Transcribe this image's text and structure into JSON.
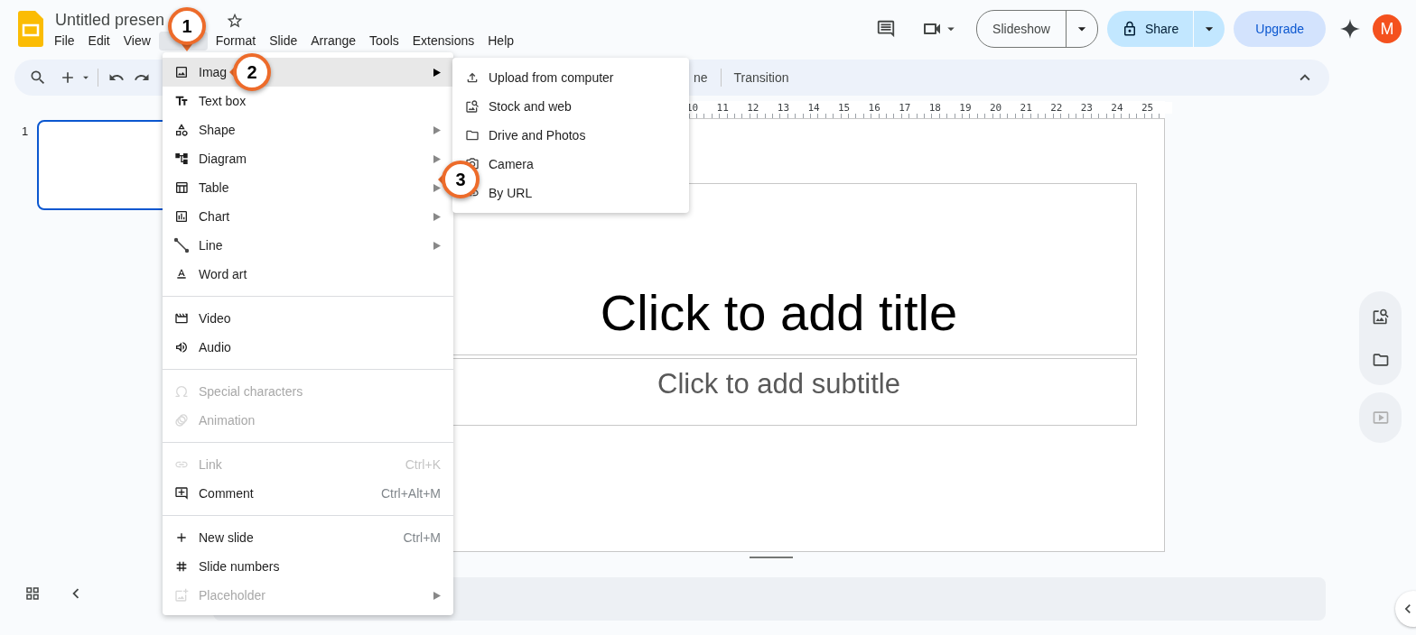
{
  "document": {
    "title": "Untitled presen",
    "starred": false
  },
  "menubar": [
    {
      "label": "File",
      "selected": false
    },
    {
      "label": "Edit",
      "selected": false
    },
    {
      "label": "View",
      "selected": false
    },
    {
      "kind": "covered",
      "selected": true
    },
    {
      "label": "Format",
      "selected": false
    },
    {
      "label": "Slide",
      "selected": false
    },
    {
      "label": "Arrange",
      "selected": false
    },
    {
      "label": "Tools",
      "selected": false
    },
    {
      "label": "Extensions",
      "selected": false
    },
    {
      "label": "Help",
      "selected": false
    }
  ],
  "header_actions": {
    "slideshow": "Slideshow",
    "share": "Share",
    "upgrade": "Upgrade",
    "avatar": "M"
  },
  "toolbar_buttons": [
    "ne",
    "Transition"
  ],
  "ruler": [
    "10",
    "11",
    "12",
    "13",
    "14",
    "15",
    "16",
    "17",
    "18",
    "19",
    "20",
    "21",
    "22",
    "23",
    "24",
    "25"
  ],
  "slides": [
    {
      "number": "1",
      "selected": true
    }
  ],
  "slide": {
    "title_placeholder": "Click to add title",
    "subtitle_placeholder": "Click to add subtitle"
  },
  "insert_menu": [
    [
      {
        "label": "Imag",
        "submenu": true,
        "disabled": false,
        "selected": true
      },
      {
        "label": "Text box",
        "submenu": false,
        "disabled": false,
        "selected": false
      },
      {
        "label": "Shape",
        "submenu": true,
        "disabled": false,
        "selected": false
      },
      {
        "label": "Diagram",
        "submenu": true,
        "disabled": false,
        "selected": false
      },
      {
        "label": "Table",
        "submenu": true,
        "disabled": false,
        "selected": false
      },
      {
        "label": "Chart",
        "submenu": true,
        "disabled": false,
        "selected": false
      },
      {
        "label": "Line",
        "submenu": true,
        "disabled": false,
        "selected": false
      },
      {
        "label": "Word art",
        "submenu": false,
        "disabled": false,
        "selected": false
      }
    ],
    [
      {
        "label": "Video",
        "submenu": false,
        "disabled": false,
        "selected": false
      },
      {
        "label": "Audio",
        "submenu": false,
        "disabled": false,
        "selected": false
      }
    ],
    [
      {
        "label": "Special characters",
        "submenu": false,
        "disabled": true,
        "selected": false
      },
      {
        "label": "Animation",
        "submenu": false,
        "disabled": true,
        "selected": false
      }
    ],
    [
      {
        "label": "Link",
        "shortcut": "Ctrl+K",
        "submenu": false,
        "disabled": true,
        "selected": false
      },
      {
        "label": "Comment",
        "shortcut": "Ctrl+Alt+M",
        "submenu": false,
        "disabled": false,
        "selected": false
      }
    ],
    [
      {
        "label": "New slide",
        "shortcut": "Ctrl+M",
        "submenu": false,
        "disabled": false,
        "selected": false
      },
      {
        "label": "Slide numbers",
        "submenu": false,
        "disabled": false,
        "selected": false
      },
      {
        "label": "Placeholder",
        "submenu": true,
        "disabled": true,
        "selected": false
      }
    ]
  ],
  "image_submenu": [
    "Upload from computer",
    "Stock and web",
    "Drive and Photos",
    "Camera",
    "By URL"
  ],
  "callouts": [
    "1",
    "2",
    "3"
  ]
}
